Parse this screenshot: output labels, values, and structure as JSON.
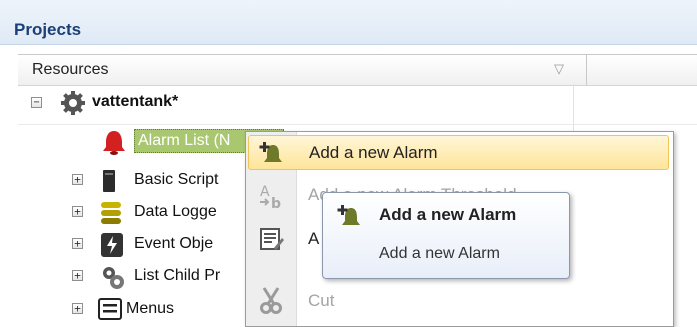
{
  "panel": {
    "title": "Projects"
  },
  "column": {
    "header": "Resources",
    "filter_icon": "filter-icon"
  },
  "tree": {
    "root": {
      "label": "vattentank*",
      "icon": "gears-icon",
      "expander": "⊟"
    },
    "items": [
      {
        "label": "Alarm List (N",
        "icon": "alarm-bell-icon",
        "selected": true
      },
      {
        "label": "Basic Script",
        "icon": "script-icon",
        "expander": "+"
      },
      {
        "label": "Data Logge",
        "icon": "database-icon",
        "expander": "+"
      },
      {
        "label": "Event Obje",
        "icon": "event-icon",
        "expander": "+"
      },
      {
        "label": "List Child Pr",
        "icon": "child-process-icon",
        "expander": "+"
      },
      {
        "label": "Menus",
        "icon": "menu-icon",
        "expander": "+"
      }
    ]
  },
  "context_menu": {
    "items": [
      {
        "label": "Add a new Alarm",
        "icon": "add-alarm-icon",
        "enabled": true,
        "highlighted": true
      },
      {
        "label": "Add a new Alarm Threshold",
        "icon": "add-threshold-icon",
        "enabled": false
      },
      {
        "label": "A",
        "icon": "properties-icon",
        "enabled": true
      },
      {
        "label": "Cut",
        "icon": "cut-icon",
        "enabled": false
      }
    ]
  },
  "tooltip": {
    "title": "Add a new Alarm",
    "description": "Add a new Alarm",
    "icon": "add-alarm-icon"
  },
  "colors": {
    "accent": "#1c3f77",
    "selection": "#a9c76f",
    "highlight": "#ffe59a"
  }
}
